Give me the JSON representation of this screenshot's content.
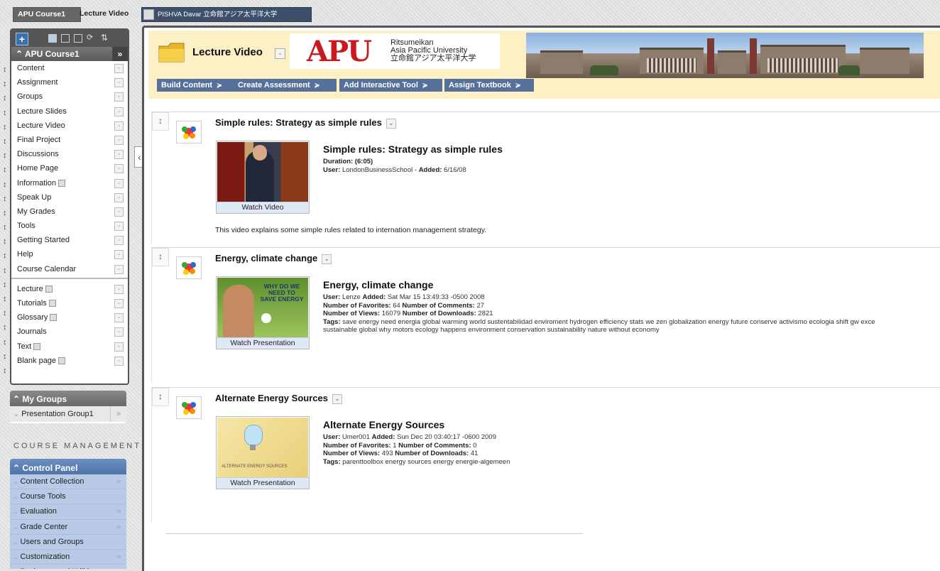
{
  "top_tabs": {
    "course": "APU Course1",
    "page": "Lecture Video",
    "user": "PISHVA Davar 立命館アジア太平洋大学"
  },
  "sidebar": {
    "course_title": "APU Course1",
    "items": [
      {
        "label": "Content"
      },
      {
        "label": "Assignment"
      },
      {
        "label": "Groups"
      },
      {
        "label": "Lecture Slides"
      },
      {
        "label": "Lecture Video"
      },
      {
        "label": "Final Project"
      },
      {
        "label": "Discussions"
      },
      {
        "label": "Home Page"
      },
      {
        "label": "Information"
      },
      {
        "label": "Speak Up"
      },
      {
        "label": "My Grades"
      },
      {
        "label": "Tools"
      },
      {
        "label": "Getting Started"
      },
      {
        "label": "Help"
      },
      {
        "label": "Course Calendar"
      }
    ],
    "items2": [
      {
        "label": "Lecture"
      },
      {
        "label": "Tutorials"
      },
      {
        "label": "Glossary"
      },
      {
        "label": "Journals"
      },
      {
        "label": "Text"
      },
      {
        "label": "Blank page"
      }
    ],
    "my_groups": {
      "title": "My Groups",
      "item": "Presentation Group1"
    },
    "course_management": "COURSE MANAGEMENT",
    "control_panel": {
      "title": "Control Panel",
      "items": [
        {
          "label": "Content Collection"
        },
        {
          "label": "Course Tools"
        },
        {
          "label": "Evaluation"
        },
        {
          "label": "Grade Center"
        },
        {
          "label": "Users and Groups"
        },
        {
          "label": "Customization"
        },
        {
          "label": "Packages and Utilities"
        }
      ]
    }
  },
  "header": {
    "title": "Lecture Video",
    "logo": {
      "mark": "APU",
      "line1": "Ritsumeikan",
      "line2": "Asia Pacific University",
      "line3": "立命館アジア太平洋大学"
    },
    "toolbar": [
      "Build Content",
      "Create Assessment",
      "Add Interactive Tool",
      "Assign Textbook"
    ]
  },
  "items": [
    {
      "title": "Simple rules: Strategy as simple rules",
      "thumb_button": "Watch Video",
      "meta_title": "Simple rules: Strategy as simple rules",
      "duration_label": "Duration:",
      "duration": "(6:05)",
      "user_label": "User:",
      "user": "LondonBusinessSchool",
      "added_label": "Added:",
      "added": "6/16/08",
      "description": "This video explains some simple rules related to internation management strategy."
    },
    {
      "title": "Energy, climate change",
      "thumb_button": "Watch Presentation",
      "thumb_text": "WHY DO WE NEED TO SAVE ENERGY",
      "meta_title": "Energy, climate change",
      "user_label": "User:",
      "user": "Lenze",
      "added_label": "Added:",
      "added": "Sat Mar 15 13:49:33 -0500 2008",
      "favorites_label": "Number of Favorites:",
      "favorites": "64",
      "comments_label": "Number of Comments:",
      "comments": "27",
      "views_label": "Number of Views:",
      "views": "16079",
      "downloads_label": "Number of Downloads:",
      "downloads": "2821",
      "tags_label": "Tags:",
      "tags_line1": "save energy need energia global warming world sustentabilidad enviroment hydrogen efficiency stats we zen globalization energy future conserve activismo ecologia shift gw exce",
      "tags_line2": "sustainable global why motors ecology happens environment conservation sustainability nature without economy"
    },
    {
      "title": "Alternate Energy Sources",
      "thumb_button": "Watch Presentation",
      "thumb_text": "ALTERNATE ENERGY SOURCES",
      "meta_title": "Alternate Energy Sources",
      "user_label": "User:",
      "user": "Umer001",
      "added_label": "Added:",
      "added": "Sun Dec 20 03:40:17 -0600 2009",
      "favorites_label": "Number of Favorites:",
      "favorites": "1",
      "comments_label": "Number of Comments:",
      "comments": "0",
      "views_label": "Number of Views:",
      "views": "493",
      "downloads_label": "Number of Downloads:",
      "downloads": "41",
      "tags_label": "Tags:",
      "tags": "parenttoolbox energy sources energy energie-algemeen"
    }
  ],
  "colors": {
    "header_bg": "#fdf0c4",
    "toolbar_btn": "#55709a",
    "control_panel": "#b8cae6",
    "apu_red": "#c8191f"
  }
}
